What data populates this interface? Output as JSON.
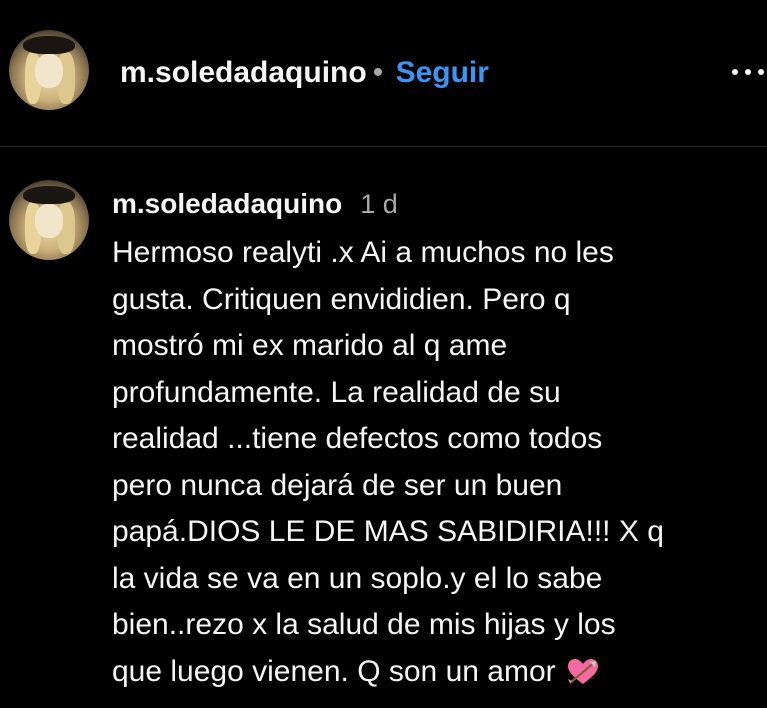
{
  "header": {
    "username": "m.soledadaquino",
    "separator": "•",
    "follow_label": "Seguir",
    "more_icon": "more-options-icon"
  },
  "comment": {
    "username": "m.soledadaquino",
    "time": "1 d",
    "lines": [
      "Hermoso realyti .x Ai a muchos no les",
      "gusta. Critiquen envididien. Pero q",
      "mostró mi ex marido al q ame",
      "profundamente. La realidad de su",
      "realidad ...tiene defectos como todos",
      "pero nunca dejará de ser un buen",
      "papá.DIOS LE DE MAS SABIDIRIA!!! X q",
      "la vida se va en un soplo.y el lo sabe",
      "bien..rezo x la salud de mis hijas y los",
      "que luego vienen. Q son un amor"
    ],
    "emoji": "heart-with-arrow-icon"
  },
  "colors": {
    "background": "#000000",
    "text": "#f5f5f5",
    "muted": "#a8a8a8",
    "link": "#3a96f5",
    "divider": "#262626",
    "heart": "#f26aa0"
  }
}
